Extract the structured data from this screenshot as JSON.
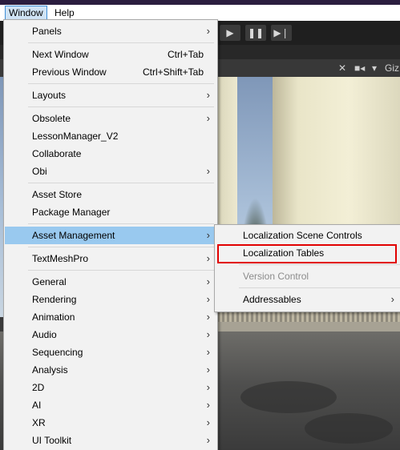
{
  "menubar": {
    "window": "Window",
    "help": "Help"
  },
  "toolbar": {
    "play_icon": "play-icon",
    "pause_icon": "pause-icon",
    "step_icon": "step-icon"
  },
  "scene_toolbar": {
    "gizmos_label": "Giz"
  },
  "main_menu": {
    "items": [
      {
        "label": "Panels",
        "submenu": true
      },
      {
        "label": "Next Window",
        "shortcut": "Ctrl+Tab"
      },
      {
        "label": "Previous Window",
        "shortcut": "Ctrl+Shift+Tab"
      },
      {
        "label": "Layouts",
        "submenu": true
      },
      {
        "label": "Obsolete",
        "submenu": true
      },
      {
        "label": "LessonManager_V2"
      },
      {
        "label": "Collaborate"
      },
      {
        "label": "Obi",
        "submenu": true
      },
      {
        "label": "Asset Store"
      },
      {
        "label": "Package Manager"
      },
      {
        "label": "Asset Management",
        "submenu": true,
        "highlighted": true
      },
      {
        "label": "TextMeshPro",
        "submenu": true
      },
      {
        "label": "General",
        "submenu": true
      },
      {
        "label": "Rendering",
        "submenu": true
      },
      {
        "label": "Animation",
        "submenu": true
      },
      {
        "label": "Audio",
        "submenu": true
      },
      {
        "label": "Sequencing",
        "submenu": true
      },
      {
        "label": "Analysis",
        "submenu": true
      },
      {
        "label": "2D",
        "submenu": true
      },
      {
        "label": "AI",
        "submenu": true
      },
      {
        "label": "XR",
        "submenu": true
      },
      {
        "label": "UI Toolkit",
        "submenu": true
      }
    ],
    "arrow": "›"
  },
  "submenu": {
    "items": [
      {
        "label": "Localization Scene Controls"
      },
      {
        "label": "Localization Tables",
        "annotated": true
      },
      {
        "label": "Version Control",
        "disabled": true
      },
      {
        "label": "Addressables",
        "submenu": true
      }
    ]
  },
  "colors": {
    "menu_bg": "#f2f2f2",
    "highlight": "#99c9ef",
    "annotation_red": "#e10000",
    "disabled_text": "#8c8c8c"
  }
}
